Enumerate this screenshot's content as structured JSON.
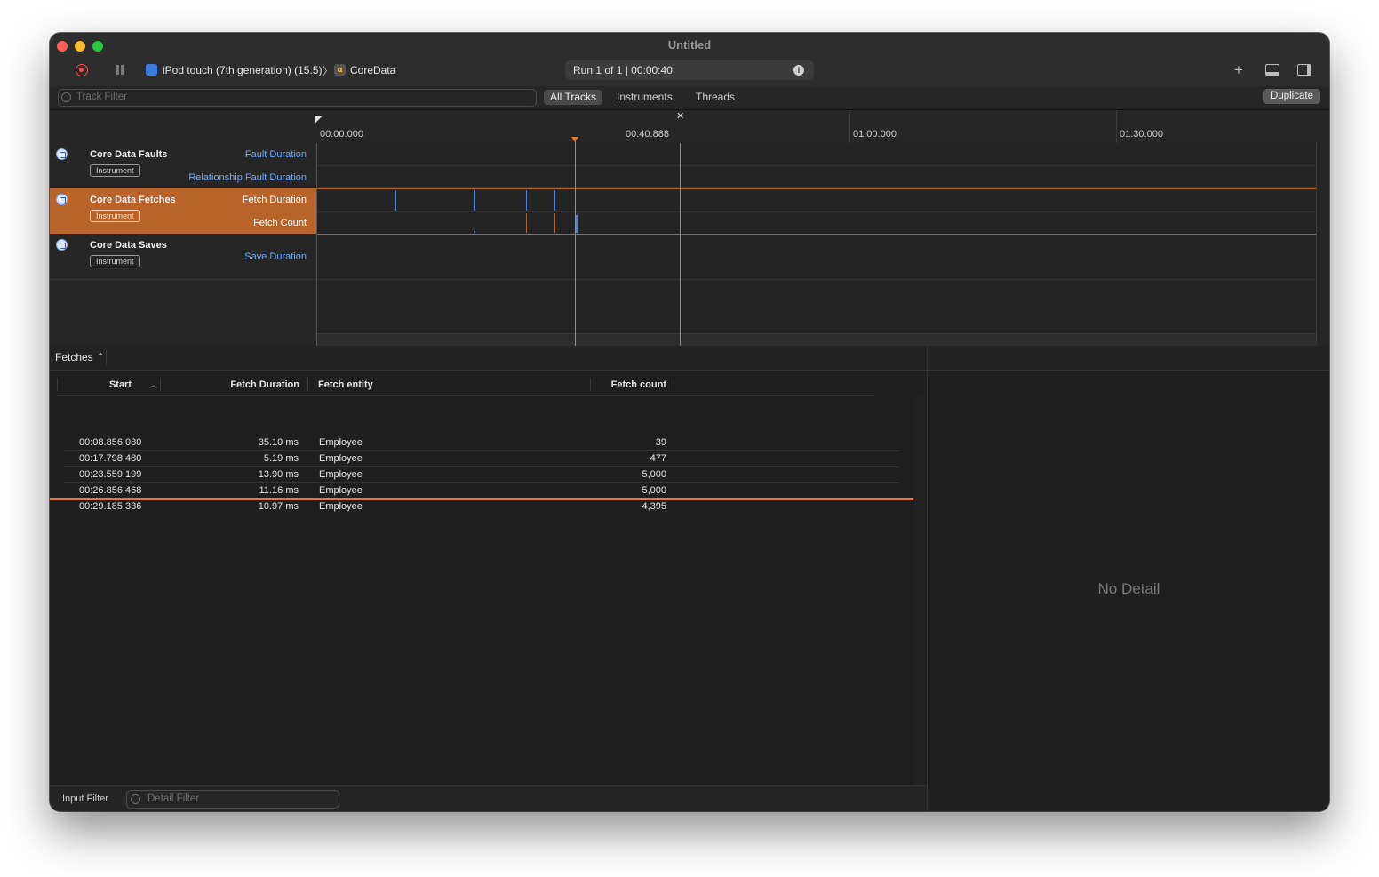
{
  "window": {
    "title": "Untitled"
  },
  "toolbar": {
    "device": "iPod touch (7th generation) (15.5)",
    "process": "CoreData",
    "run_status": "Run 1 of 1  |  00:00:40"
  },
  "filterbar": {
    "track_filter_placeholder": "Track Filter",
    "tabs": [
      "All Tracks",
      "Instruments",
      "Threads"
    ],
    "duplicate_label": "Duplicate"
  },
  "ruler": {
    "ticks": [
      "00:00.000",
      "00:40.888",
      "01:00.000",
      "01:30.000"
    ]
  },
  "instruments": [
    {
      "name": "Core Data Faults",
      "badge": "Instrument",
      "lanes": [
        "Fault Duration",
        "Relationship Fault Duration"
      ]
    },
    {
      "name": "Core Data Fetches",
      "badge": "Instrument",
      "lanes": [
        "Fetch Duration",
        "Fetch Count"
      ]
    },
    {
      "name": "Core Data Saves",
      "badge": "Instrument",
      "lanes": [
        "Save Duration"
      ]
    }
  ],
  "table": {
    "selector_label": "Fetches ⌃",
    "columns": [
      "Start",
      "Fetch Duration",
      "Fetch entity",
      "Fetch count"
    ],
    "rows": [
      {
        "start": "00:08.856.080",
        "duration": "35.10 ms",
        "entity": "Employee",
        "count": "39"
      },
      {
        "start": "00:17.798.480",
        "duration": "5.19 ms",
        "entity": "Employee",
        "count": "477"
      },
      {
        "start": "00:23.559.199",
        "duration": "13.90 ms",
        "entity": "Employee",
        "count": "5,000"
      },
      {
        "start": "00:26.856.468",
        "duration": "11.16 ms",
        "entity": "Employee",
        "count": "5,000"
      },
      {
        "start": "00:29.185.336",
        "duration": "10.97 ms",
        "entity": "Employee",
        "count": "4,395"
      }
    ]
  },
  "bottom": {
    "input_filter_label": "Input Filter",
    "detail_filter_placeholder": "Detail Filter"
  },
  "detail": {
    "empty_text": "No Detail"
  },
  "colors": {
    "accent": "#b8632a",
    "lane_text": "#6ea8ff",
    "record": "#ff4d4d"
  }
}
